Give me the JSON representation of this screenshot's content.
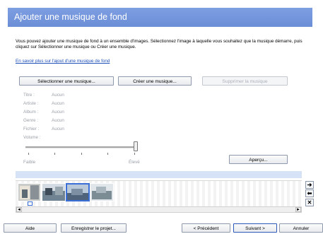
{
  "header": {
    "title": "Ajouter une musique de fond"
  },
  "intro": {
    "text": "Vous pouvez ajouter une musique de fond à un ensemble d'images. Sélectionnez l'image à laquelle vous souhaitez que la musique démarre, puis cliquez sur Sélectionner une musique ou Créer une musique.",
    "link": "En savoir plus sur l'ajout d'une musique de fond"
  },
  "actions": {
    "select_music": "Sélectionner une musique...",
    "create_music": "Créer une musique...",
    "remove_music": "Supprimer la musique"
  },
  "metadata": [
    {
      "label": "Titre :",
      "value": "Aucun"
    },
    {
      "label": "Artiste :",
      "value": "Aucun"
    },
    {
      "label": "Album :",
      "value": "Aucun"
    },
    {
      "label": "Genre :",
      "value": "Aucun"
    },
    {
      "label": "Fichier :",
      "value": "Aucun"
    },
    {
      "label": "Volume :",
      "value": ""
    }
  ],
  "volume": {
    "low_label": "Faible",
    "high_label": "Élevé",
    "level": 1.0
  },
  "preview_button": "Aperçu...",
  "filmstrip": {
    "selected_index": 2,
    "thumbnails": [
      "photo-1",
      "photo-2",
      "photo-3",
      "photo-4"
    ]
  },
  "side_controls": [
    "arrow-right-icon",
    "arrow-left-icon",
    "close-icon"
  ],
  "footer": {
    "help": "Aide",
    "save_project": "Enregistrer le projet...",
    "previous": "< Précédent",
    "next": "Suivant >",
    "cancel": "Annuler"
  },
  "colors": {
    "header": "#7394dc",
    "accent": "#3a6fd8"
  }
}
